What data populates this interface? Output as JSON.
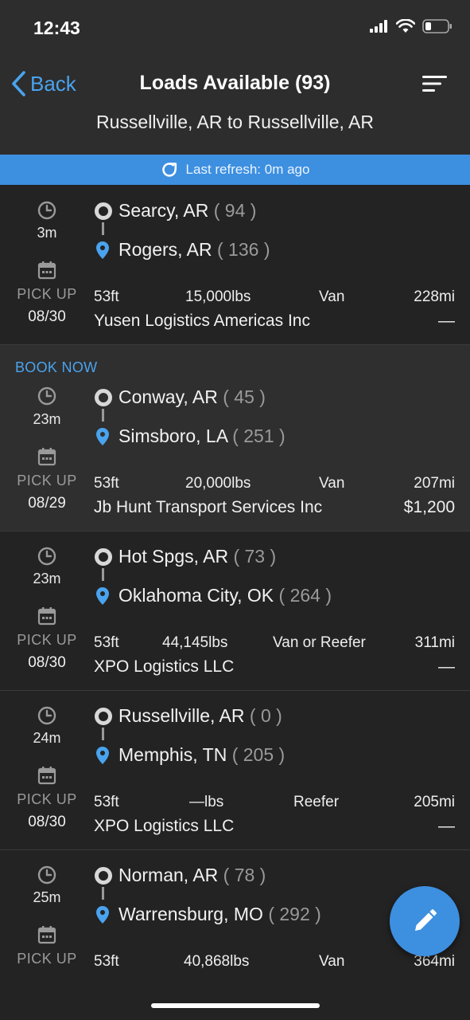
{
  "status_bar": {
    "time": "12:43"
  },
  "nav": {
    "back_label": "Back",
    "title": "Loads Available (93)",
    "route": "Russellville, AR to Russellville, AR"
  },
  "refresh": {
    "text": "Last refresh: 0m ago"
  },
  "loads": [
    {
      "age": "3m",
      "origin": "Searcy, AR",
      "origin_count": "( 94 )",
      "destination": "Rogers, AR",
      "destination_count": "( 136 )",
      "pickup_label": "PICK UP",
      "pickup_date": "08/30",
      "length": "53ft",
      "weight": "15,000lbs",
      "equipment": "Van",
      "distance": "228mi",
      "company": "Yusen Logistics Americas Inc",
      "rate": "—"
    },
    {
      "book_now": "BOOK NOW",
      "age": "23m",
      "origin": "Conway, AR",
      "origin_count": "( 45 )",
      "destination": "Simsboro, LA",
      "destination_count": "( 251 )",
      "pickup_label": "PICK UP",
      "pickup_date": "08/29",
      "length": "53ft",
      "weight": "20,000lbs",
      "equipment": "Van",
      "distance": "207mi",
      "company": "Jb Hunt Transport Services Inc",
      "rate": "$1,200"
    },
    {
      "age": "23m",
      "origin": "Hot Spgs, AR",
      "origin_count": "( 73 )",
      "destination": "Oklahoma City, OK",
      "destination_count": "( 264 )",
      "pickup_label": "PICK UP",
      "pickup_date": "08/30",
      "length": "53ft",
      "weight": "44,145lbs",
      "equipment": "Van or Reefer",
      "distance": "311mi",
      "company": "XPO Logistics LLC",
      "rate": "—"
    },
    {
      "age": "24m",
      "origin": "Russellville, AR",
      "origin_count": "( 0 )",
      "destination": "Memphis, TN",
      "destination_count": "( 205 )",
      "pickup_label": "PICK UP",
      "pickup_date": "08/30",
      "length": "53ft",
      "weight": "—lbs",
      "equipment": "Reefer",
      "distance": "205mi",
      "company": "XPO Logistics LLC",
      "rate": "—"
    },
    {
      "age": "25m",
      "origin": "Norman, AR",
      "origin_count": "( 78 )",
      "destination": "Warrensburg, MO",
      "destination_count": "( 292 )",
      "pickup_label": "PICK UP",
      "length": "53ft",
      "weight": "40,868lbs",
      "equipment": "Van",
      "distance": "364mi"
    }
  ],
  "colors": {
    "accent": "#3d8fe0",
    "link": "#4aa3ee",
    "background": "#212121",
    "header": "#2d2d2d"
  },
  "icons": [
    "back-chevron-icon",
    "sort-icon",
    "refresh-icon",
    "clock-icon",
    "calendar-icon",
    "origin-circle-icon",
    "map-pin-icon",
    "pencil-icon"
  ]
}
